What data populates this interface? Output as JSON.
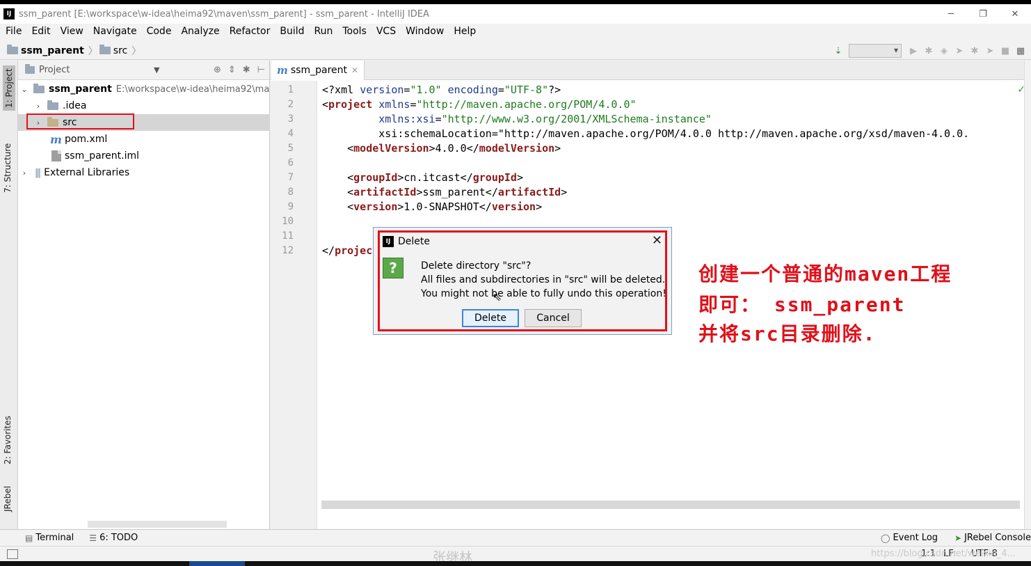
{
  "window": {
    "title": "ssm_parent [E:\\workspace\\w-idea\\heima92\\maven\\ssm_parent] - ssm_parent - IntelliJ IDEA",
    "app_logo": "IJ",
    "minimize": "─",
    "restore": "❐",
    "close": "✕"
  },
  "menu": [
    "File",
    "Edit",
    "View",
    "Navigate",
    "Code",
    "Analyze",
    "Refactor",
    "Build",
    "Run",
    "Tools",
    "VCS",
    "Window",
    "Help"
  ],
  "breadcrumb": {
    "project": "ssm_parent",
    "folder": "src",
    "sep": "〉"
  },
  "left_tool_tabs": {
    "project": "1: Project",
    "structure": "7: Structure",
    "favorites": "2: Favorites",
    "jrebel": "JRebel"
  },
  "project_panel": {
    "header": "Project",
    "tree": [
      {
        "name": "ssm_parent",
        "path": "E:\\workspace\\w-idea\\heima92\\ma"
      },
      {
        "name": ".idea"
      },
      {
        "name": "src"
      },
      {
        "name": "pom.xml"
      },
      {
        "name": "ssm_parent.iml"
      },
      {
        "name": "External Libraries"
      }
    ]
  },
  "editor": {
    "tab_label": "ssm_parent",
    "tab_icon": "m",
    "line_numbers": [
      "1",
      "2",
      "3",
      "4",
      "5",
      "6",
      "7",
      "8",
      "9",
      "10",
      "11",
      "12"
    ],
    "lines": [
      "<?xml version=\"1.0\" encoding=\"UTF-8\"?>",
      "<project xmlns=\"http://maven.apache.org/POM/4.0.0\"",
      "         xmlns:xsi=\"http://www.w3.org/2001/XMLSchema-instance\"",
      "         xsi:schemaLocation=\"http://maven.apache.org/POM/4.0.0 http://maven.apache.org/xsd/maven-4.0.0.",
      "    <modelVersion>4.0.0</modelVersion>",
      "",
      "    <groupId>cn.itcast</groupId>",
      "    <artifactId>ssm_parent</artifactId>",
      "    <version>1.0-SNAPSHOT</version>",
      "",
      "",
      "</project>"
    ]
  },
  "dialog": {
    "title": "Delete",
    "question_mark": "?",
    "line1": "Delete directory \"src\"?",
    "line2": "All files and subdirectories in \"src\" will be deleted.",
    "line3": "You might not be able to fully undo this operation!",
    "delete_label": "Delete",
    "cancel_label": "Cancel",
    "close": "✕"
  },
  "annotation": {
    "line1": "创建一个普通的maven工程",
    "line2": "即可： ssm_parent",
    "line3": "并将src目录删除."
  },
  "bottom_tools": {
    "terminal": "Terminal",
    "todo": "6: TODO",
    "event_log": "Event Log",
    "jrebel_console": "JRebel Console"
  },
  "status": {
    "position": "1:1",
    "line_sep": "LF:",
    "encoding": "UTF-8"
  },
  "watermarks": {
    "center": "张继林",
    "url": "https://blog.csdn.net/weixin_4..."
  },
  "colors": {
    "highlight_red": "#e0101a",
    "xml_tag": "#8a1a1a",
    "xml_attr": "#1f3a8a",
    "xml_string": "#1f7a1f"
  }
}
